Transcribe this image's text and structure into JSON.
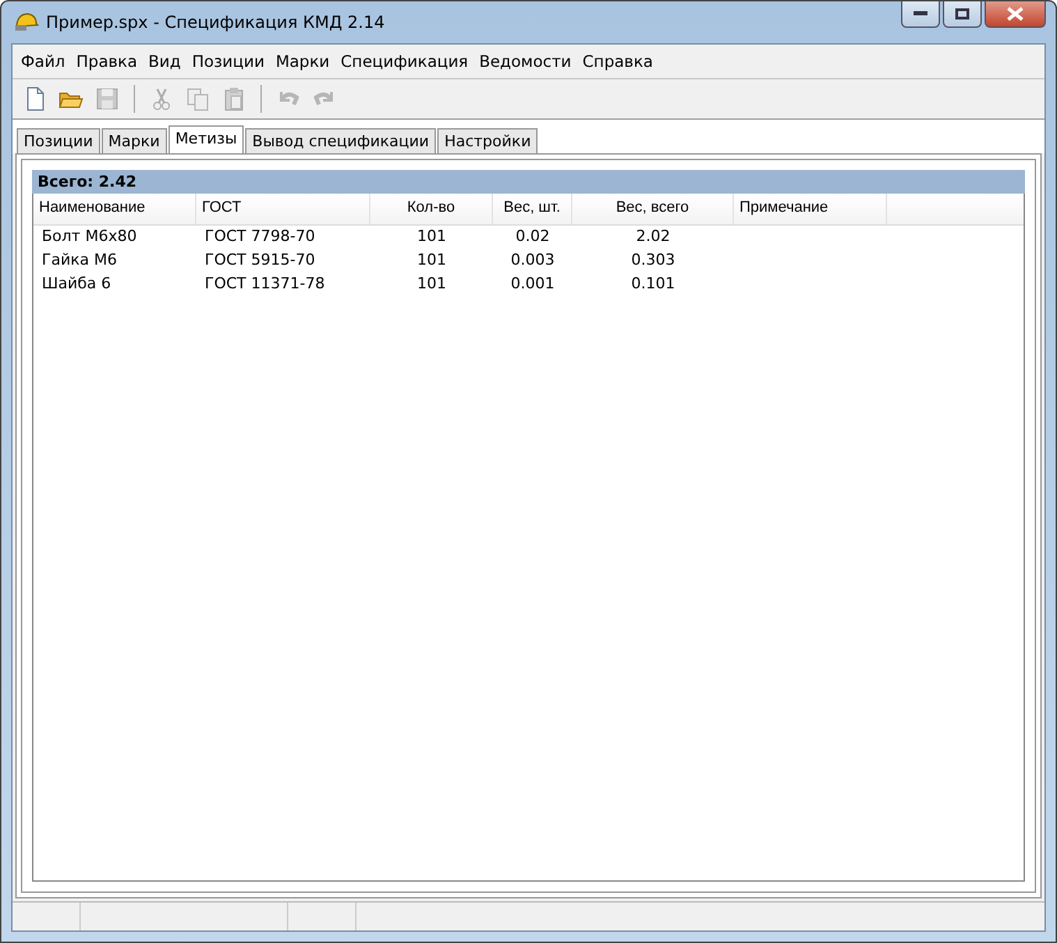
{
  "window": {
    "title": "Пример.spx - Спецификация КМД 2.14"
  },
  "menu": [
    "Файл",
    "Правка",
    "Вид",
    "Позиции",
    "Марки",
    "Спецификация",
    "Ведомости",
    "Справка"
  ],
  "toolbar": [
    {
      "kind": "new",
      "disabled": false
    },
    {
      "kind": "open",
      "disabled": false
    },
    {
      "kind": "save",
      "disabled": true
    },
    {
      "kind": "sep"
    },
    {
      "kind": "cut",
      "disabled": true
    },
    {
      "kind": "copy",
      "disabled": true
    },
    {
      "kind": "paste",
      "disabled": true
    },
    {
      "kind": "sep"
    },
    {
      "kind": "undo",
      "disabled": true
    },
    {
      "kind": "redo",
      "disabled": true
    }
  ],
  "tabs": [
    {
      "label": "Позиции",
      "selected": false
    },
    {
      "label": "Марки",
      "selected": false
    },
    {
      "label": "Метизы",
      "selected": true
    },
    {
      "label": "Вывод спецификации",
      "selected": false
    },
    {
      "label": "Настройки",
      "selected": false
    }
  ],
  "summary": "Всего: 2.42",
  "table": {
    "columns": [
      "Наименование",
      "ГОСТ",
      "Кол-во",
      "Вес, шт.",
      "Вес, всего",
      "Примечание"
    ],
    "rows": [
      [
        "Болт М6х80",
        "ГОСТ 7798-70",
        "101",
        "0.02",
        "2.02"
      ],
      [
        "Гайка М6",
        "ГОСТ 5915-70",
        "101",
        "0.003",
        "0.303"
      ],
      [
        "Шайба 6",
        "ГОСТ 11371-78",
        "101",
        "0.001",
        "0.101"
      ]
    ]
  }
}
